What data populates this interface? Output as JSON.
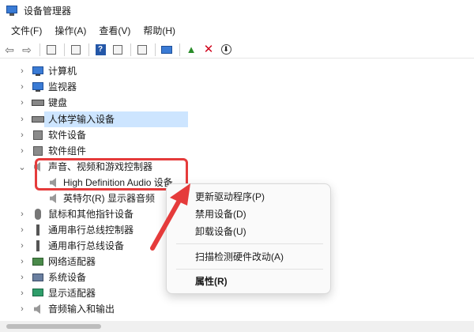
{
  "window": {
    "title": "设备管理器"
  },
  "menu": {
    "file": "文件(F)",
    "action": "操作(A)",
    "view": "查看(V)",
    "help": "帮助(H)"
  },
  "toolbar": {
    "back": "back-icon",
    "forward": "forward-icon",
    "properties": "properties-icon",
    "help": "?",
    "scan": "scan-icon",
    "update": "update-driver-icon",
    "uninstall": "✕",
    "disable": "⬇"
  },
  "tree": {
    "items": [
      {
        "label": "计算机",
        "icon": "computer-icon",
        "expanded": false
      },
      {
        "label": "监视器",
        "icon": "monitor-icon",
        "expanded": false
      },
      {
        "label": "键盘",
        "icon": "keyboard-icon",
        "expanded": false
      },
      {
        "label": "人体学输入设备",
        "icon": "hid-icon",
        "expanded": false
      },
      {
        "label": "软件设备",
        "icon": "software-device-icon",
        "expanded": false
      },
      {
        "label": "软件组件",
        "icon": "software-component-icon",
        "expanded": false
      },
      {
        "label": "声音、视频和游戏控制器",
        "icon": "sound-icon",
        "expanded": true
      },
      {
        "label": "High Definition Audio 设备",
        "icon": "speaker-icon",
        "child": true,
        "selected": true
      },
      {
        "label": "英特尔(R) 显示器音频",
        "icon": "speaker-icon",
        "child": true
      },
      {
        "label": "鼠标和其他指针设备",
        "icon": "mouse-icon",
        "expanded": false
      },
      {
        "label": "通用串行总线控制器",
        "icon": "usb-icon",
        "expanded": false
      },
      {
        "label": "通用串行总线设备",
        "icon": "usb-icon",
        "expanded": false
      },
      {
        "label": "网络适配器",
        "icon": "network-icon",
        "expanded": false
      },
      {
        "label": "系统设备",
        "icon": "system-icon",
        "expanded": false
      },
      {
        "label": "显示适配器",
        "icon": "display-adapter-icon",
        "expanded": false
      },
      {
        "label": "音频输入和输出",
        "icon": "audio-io-icon",
        "expanded": false
      }
    ]
  },
  "context_menu": {
    "update_driver": "更新驱动程序(P)",
    "disable_device": "禁用设备(D)",
    "uninstall_device": "卸载设备(U)",
    "scan_hardware": "扫描检测硬件改动(A)",
    "properties": "属性(R)"
  },
  "colors": {
    "highlight_red": "#e53b3b",
    "selection": "#cde5ff"
  }
}
